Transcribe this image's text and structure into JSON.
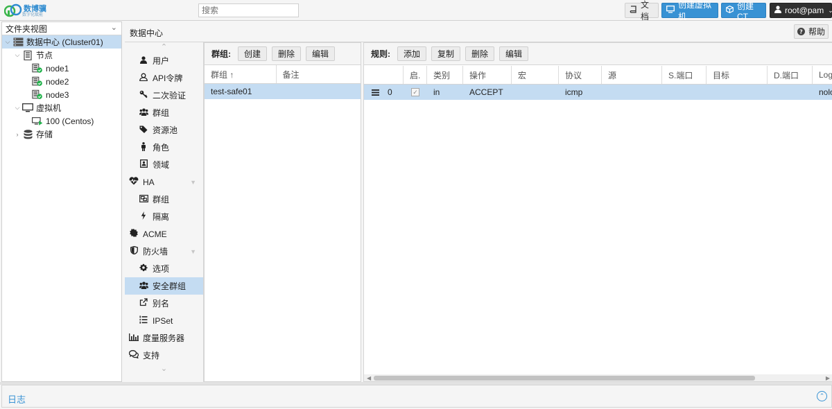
{
  "app": {
    "logo_text": "数博骥",
    "logo_subtext": "数字化赋能",
    "search_placeholder": "搜索",
    "buttons": {
      "docs": "文档",
      "create_vm": "创建虚拟机",
      "create_ct": "创建CT",
      "user": "root@pam"
    }
  },
  "tree": {
    "view_label": "文件夹视图",
    "items": [
      {
        "label": "数据中心 (Cluster01)",
        "icon": "server-rack-icon",
        "level": 0,
        "expander": "collapse",
        "selected": true
      },
      {
        "label": "节点",
        "icon": "node-folder-icon",
        "level": 1,
        "expander": "collapse"
      },
      {
        "label": "node1",
        "icon": "node-online-icon",
        "level": 2
      },
      {
        "label": "node2",
        "icon": "node-online-icon",
        "level": 2
      },
      {
        "label": "node3",
        "icon": "node-online-icon",
        "level": 2
      },
      {
        "label": "虚拟机",
        "icon": "monitor-icon",
        "level": 1,
        "expander": "collapse"
      },
      {
        "label": "100 (Centos)",
        "icon": "vm-running-icon",
        "level": 2
      },
      {
        "label": "存储",
        "icon": "database-icon",
        "level": 1,
        "expander": "expand"
      }
    ]
  },
  "breadcrumb": "数据中心",
  "help_label": "帮助",
  "menu": {
    "items": [
      {
        "label": "用户",
        "icon": "user-icon",
        "level": 2
      },
      {
        "label": "API令牌",
        "icon": "token-icon",
        "level": 2
      },
      {
        "label": "二次验证",
        "icon": "key-icon",
        "level": 2
      },
      {
        "label": "群组",
        "icon": "users-icon",
        "level": 2
      },
      {
        "label": "资源池",
        "icon": "tags-icon",
        "level": 2
      },
      {
        "label": "角色",
        "icon": "male-icon",
        "level": 2
      },
      {
        "label": "领域",
        "icon": "address-book-icon",
        "level": 2
      },
      {
        "label": "HA",
        "icon": "heartbeat-icon",
        "level": 1,
        "toggle": true
      },
      {
        "label": "群组",
        "icon": "object-group-icon",
        "level": 2
      },
      {
        "label": "隔离",
        "icon": "bolt-icon",
        "level": 2
      },
      {
        "label": "ACME",
        "icon": "certificate-icon",
        "level": 1
      },
      {
        "label": "防火墙",
        "icon": "shield-icon",
        "level": 1,
        "toggle": true
      },
      {
        "label": "选项",
        "icon": "gear-icon",
        "level": 2
      },
      {
        "label": "安全群组",
        "icon": "users-icon",
        "level": 2,
        "selected": true
      },
      {
        "label": "别名",
        "icon": "external-link-icon",
        "level": 2
      },
      {
        "label": "IPSet",
        "icon": "list-ol-icon",
        "level": 2
      },
      {
        "label": "度量服务器",
        "icon": "bar-chart-icon",
        "level": 1
      },
      {
        "label": "支持",
        "icon": "comments-icon",
        "level": 1
      }
    ]
  },
  "groups_panel": {
    "title": "群组:",
    "buttons": [
      "创建",
      "删除",
      "编辑"
    ],
    "columns": [
      "群组 ↑",
      "备注"
    ],
    "rows": [
      {
        "group": "test-safe01",
        "comment": ""
      }
    ]
  },
  "rules_panel": {
    "title": "规则:",
    "buttons": [
      "添加",
      "复制",
      "删除",
      "编辑"
    ],
    "columns": [
      "",
      "启.",
      "类别",
      "操作",
      "宏",
      "协议",
      "源",
      "S.端口",
      "目标",
      "D.端口",
      "Log"
    ],
    "rows": [
      {
        "pos": "0",
        "enabled": true,
        "type": "in",
        "action": "ACCEPT",
        "macro": "",
        "proto": "icmp",
        "source": "",
        "sport": "",
        "dest": "",
        "dport": "",
        "log": "nolo"
      }
    ]
  },
  "log_panel": {
    "title": "日志"
  },
  "colors": {
    "accent": "#3892d4",
    "selected_row": "#c4dcf2",
    "user_button": "#2f2f2f"
  }
}
